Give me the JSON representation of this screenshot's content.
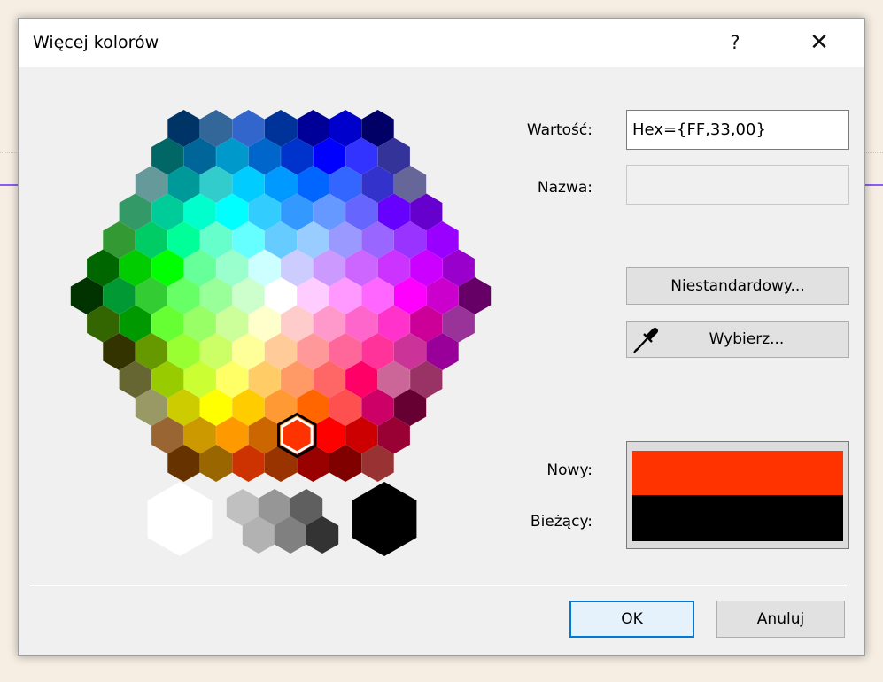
{
  "dialog": {
    "title": "Więcej kolorów",
    "help_label": "?",
    "close_label": "✕"
  },
  "form": {
    "value_label": "Wartość:",
    "value": "Hex={FF,33,00}",
    "name_label": "Nazwa:",
    "name_value": "",
    "custom_button": "Niestandardowy...",
    "pick_button": "Wybierz...",
    "new_label": "Nowy:",
    "current_label": "Bieżący:"
  },
  "colors": {
    "new": "#FF3300",
    "current": "#000000",
    "selected": "#FF3300"
  },
  "footer": {
    "ok": "OK",
    "cancel": "Anuluj"
  },
  "icons": {
    "pick": "eyedropper-icon",
    "help": "question-icon",
    "close": "close-icon"
  },
  "palette": {
    "rows": [
      [
        "#003366",
        "#336699",
        "#3366CC",
        "#003399",
        "#000099",
        "#0000CC",
        "#000066"
      ],
      [
        "#006666",
        "#006699",
        "#0099CC",
        "#0066CC",
        "#0033CC",
        "#0000FF",
        "#3333FF",
        "#333399"
      ],
      [
        "#669999",
        "#009999",
        "#33CCCC",
        "#00CCFF",
        "#0099FF",
        "#0066FF",
        "#3366FF",
        "#3333CC",
        "#666699"
      ],
      [
        "#339966",
        "#00CC99",
        "#00FFCC",
        "#00FFFF",
        "#33CCFF",
        "#3399FF",
        "#6699FF",
        "#6666FF",
        "#6600FF",
        "#6600CC"
      ],
      [
        "#339933",
        "#00CC66",
        "#00FF99",
        "#66FFCC",
        "#66FFFF",
        "#66CCFF",
        "#99CCFF",
        "#9999FF",
        "#9966FF",
        "#9933FF",
        "#9900FF"
      ],
      [
        "#006600",
        "#00CC00",
        "#00FF00",
        "#66FF99",
        "#99FFCC",
        "#CCFFFF",
        "#CCCCFF",
        "#CC99FF",
        "#CC66FF",
        "#CC33FF",
        "#CC00FF",
        "#9900CC"
      ],
      [
        "#003300",
        "#009933",
        "#33CC33",
        "#66FF66",
        "#99FF99",
        "#CCFFCC",
        "#FFFFFF",
        "#FFCCFF",
        "#FF99FF",
        "#FF66FF",
        "#FF00FF",
        "#CC00CC",
        "#660066"
      ],
      [
        "#336600",
        "#009900",
        "#66FF33",
        "#99FF66",
        "#CCFF99",
        "#FFFFCC",
        "#FFCCCC",
        "#FF99CC",
        "#FF66CC",
        "#FF33CC",
        "#CC0099",
        "#993399"
      ],
      [
        "#333300",
        "#669900",
        "#99FF33",
        "#CCFF66",
        "#FFFF99",
        "#FFCC99",
        "#FF9999",
        "#FF6699",
        "#FF3399",
        "#CC3399",
        "#990099"
      ],
      [
        "#666633",
        "#99CC00",
        "#CCFF33",
        "#FFFF66",
        "#FFCC66",
        "#FF9966",
        "#FF6666",
        "#FF0066",
        "#CC6699",
        "#993366"
      ],
      [
        "#999966",
        "#CCCC00",
        "#FFFF00",
        "#FFCC00",
        "#FF9933",
        "#FF6600",
        "#FF5050",
        "#CC0066",
        "#660033"
      ],
      [
        "#996633",
        "#CC9900",
        "#FF9900",
        "#CC6600",
        "#FF3300",
        "#FF0000",
        "#CC0000",
        "#990033"
      ],
      [
        "#663300",
        "#996600",
        "#CC3300",
        "#993300",
        "#990000",
        "#800000",
        "#993333"
      ]
    ],
    "grays": [
      "#C0C0C0",
      "#969696",
      "#5F5F5F",
      "#B2B2B2",
      "#808080",
      "#333333"
    ],
    "white": "#FFFFFF",
    "black": "#000000"
  }
}
